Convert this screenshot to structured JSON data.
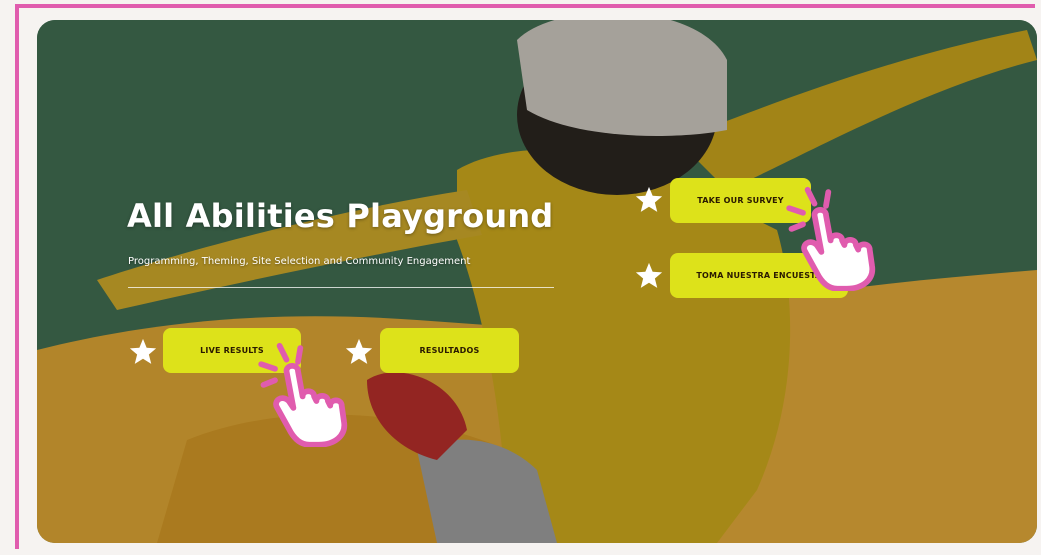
{
  "hero": {
    "title": "All Abilities Playground",
    "subtitle": "Programming, Theming, Site Selection and Community Engagement"
  },
  "buttons": {
    "live_results": "LIVE RESULTS",
    "resultados": "RESULTADOS",
    "take_survey": "TAKE OUR SURVEY",
    "toma_encuesta": "TOMA NUESTRA ENCUESTA"
  },
  "icons": {
    "star": "star-icon",
    "hand": "pointing-hand-icon"
  },
  "colors": {
    "frame_border": "#e05cae",
    "button_bg": "#dde21a",
    "button_text": "#2a1a00",
    "text_light": "#ffffff",
    "accent_pink": "#e05cae"
  }
}
